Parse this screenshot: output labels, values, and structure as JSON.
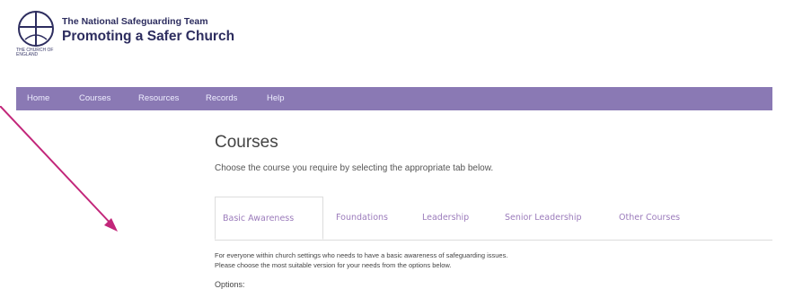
{
  "header": {
    "logo_caption": "THE CHURCH OF ENGLAND",
    "team_name": "The National Safeguarding Team",
    "slogan": "Promoting a Safer Church"
  },
  "nav": {
    "items": [
      "Home",
      "Courses",
      "Resources",
      "Records",
      "Help"
    ]
  },
  "main": {
    "title": "Courses",
    "description": "Choose the course you require by selecting the appropriate tab below.",
    "tabs": [
      "Basic Awareness",
      "Foundations",
      "Leadership",
      "Senior Leadership",
      "Other Courses"
    ],
    "active_tab": "Basic Awareness",
    "body_line1": "For everyone within church settings who needs to have a basic awareness of safeguarding issues.",
    "body_line2": "Please choose the most suitable version for your needs from the options below.",
    "options_label": "Options:"
  },
  "colors": {
    "nav_bg": "#8a79b4",
    "brand_text": "#2d2d5f",
    "tab_text": "#9b7bbb",
    "arrow": "#c2267a"
  },
  "icons": {
    "logo": "church-of-england-logo-icon",
    "pointer": "annotation-arrow-icon"
  }
}
